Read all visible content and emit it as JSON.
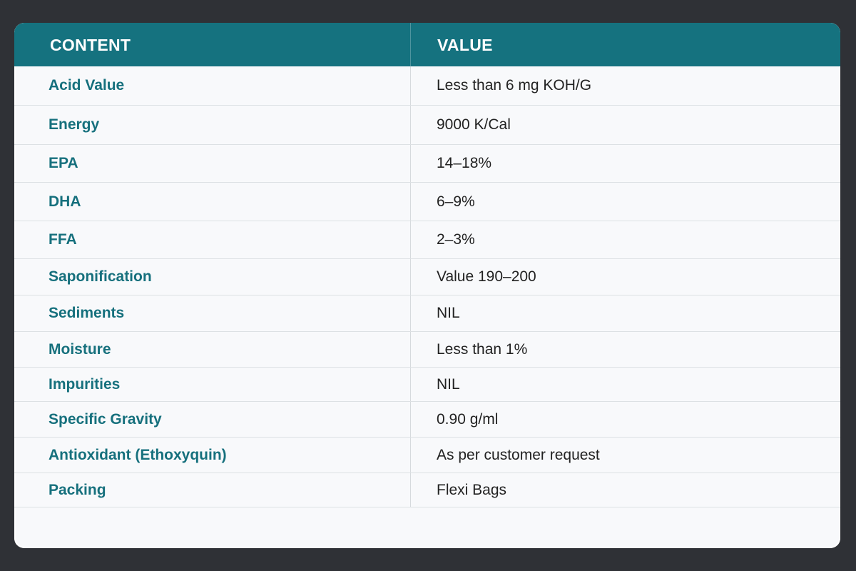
{
  "table": {
    "headers": {
      "content": "CONTENT",
      "value": "VALUE"
    },
    "rows": [
      {
        "content": "Acid Value",
        "value": "Less than 6 mg KOH/G"
      },
      {
        "content": "Energy",
        "value": "9000 K/Cal"
      },
      {
        "content": "EPA",
        "value": "14–18%"
      },
      {
        "content": "DHA",
        "value": "6–9%"
      },
      {
        "content": "FFA",
        "value": "2–3%"
      },
      {
        "content": "Saponification",
        "value": "Value 190–200"
      },
      {
        "content": "Sediments",
        "value": "NIL"
      },
      {
        "content": "Moisture",
        "value": "Less than 1%"
      },
      {
        "content": "Impurities",
        "value": "NIL"
      },
      {
        "content": "Specific Gravity",
        "value": "0.90 g/ml"
      },
      {
        "content": "Antioxidant (Ethoxyquin)",
        "value": "As per customer request"
      },
      {
        "content": "Packing",
        "value": "Flexi Bags"
      }
    ]
  },
  "colors": {
    "header_bg": "#15727f",
    "key_text": "#16707d",
    "page_bg": "#2f3136",
    "card_bg": "#f8f9fb"
  }
}
